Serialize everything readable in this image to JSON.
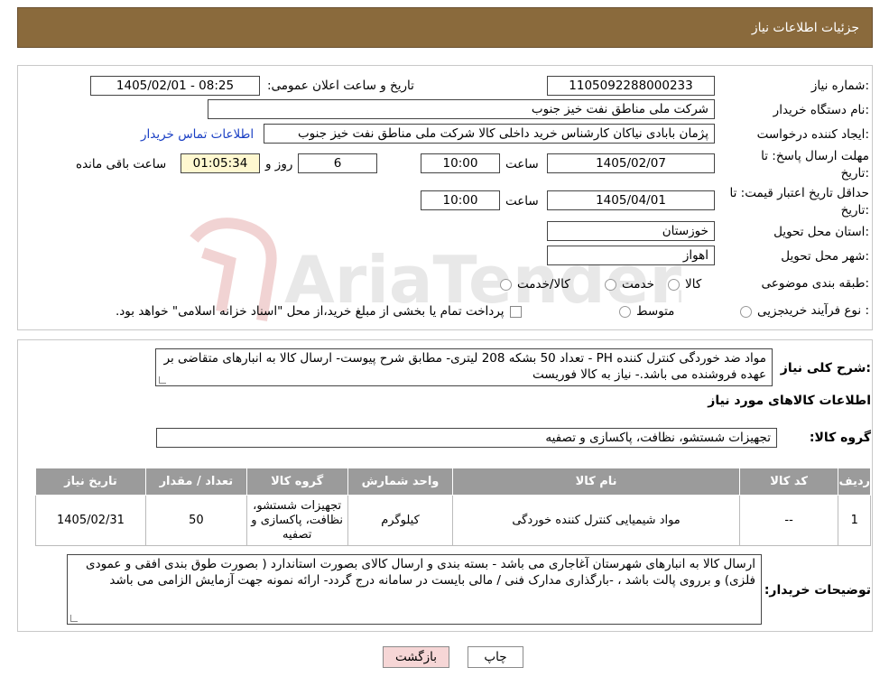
{
  "header": {
    "title": "جزئیات اطلاعات نیاز"
  },
  "form": {
    "need_number_label": "شماره نیاز:",
    "need_number": "1105092288000233",
    "announce_label": "تاریخ و ساعت اعلان عمومی:",
    "announce_value": "1405/02/01 - 08:25",
    "buyer_org_label": "نام دستگاه خریدار:",
    "buyer_org": "شرکت ملی مناطق نفت خیز جنوب",
    "requester_label": "ایجاد کننده درخواست:",
    "requester": "پژمان  بابادی نیاکان  کارشناس خرید داخلی کالا  شرکت ملی مناطق نفت خیز جنوب",
    "contact_link": "اطلاعات تماس خریدار",
    "deadline_label_1": "مهلت ارسال پاسخ: تا",
    "deadline_label_2": "تاریخ:",
    "deadline_date": "1405/02/07",
    "time_label": "ساعت",
    "deadline_time": "10:00",
    "days_value": "6",
    "days_label": "روز و",
    "remaining_time": "01:05:34",
    "remaining_label": "ساعت باقی مانده",
    "price_validity_label_1": "حداقل تاریخ اعتبار قیمت: تا",
    "price_validity_label_2": "تاریخ:",
    "price_validity_date": "1405/04/01",
    "price_validity_time": "10:00",
    "province_label": "استان محل تحویل:",
    "province": "خوزستان",
    "city_label": "شهر محل تحویل:",
    "city": "اهواز",
    "category_label": "طبقه بندی موضوعی:",
    "category_options": [
      "کالا",
      "خدمت",
      "کالا/خدمت"
    ],
    "purchase_type_label": "نوع فرآیند خرید :",
    "purchase_options": [
      "جزیی",
      "متوسط"
    ],
    "purchase_note": "پرداخت تمام یا بخشی از مبلغ خرید،از محل \"اسناد خزانه اسلامی\" خواهد بود."
  },
  "summary": {
    "label": "شرح کلی نیاز:",
    "text": "مواد ضد خوردگی کنترل کننده PH - تعداد 50 بشکه 208 لیتری- مطابق شرح پیوست- ارسال کالا به انبارهای متقاضی بر عهده فروشنده می باشد.- نیاز به کالا فوریست",
    "items_title": "اطلاعات کالاهای مورد نیاز",
    "group_label": "گروه کالا:",
    "group_value": "تجهیزات شستشو، نظافت، پاکسازی و تصفیه"
  },
  "table": {
    "headers": [
      "ردیف",
      "کد کالا",
      "نام کالا",
      "واحد شمارش",
      "گروه کالا",
      "تعداد / مقدار",
      "تاریخ نیاز"
    ],
    "rows": [
      [
        "1",
        "--",
        "مواد شیمیایی کنترل کننده خوردگی",
        "کیلوگرم",
        "تجهیزات شستشو، نظافت، پاکسازی و تصفیه",
        "50",
        "1405/02/31"
      ]
    ]
  },
  "buyer_notes": {
    "label": "توضیحات خریدار:",
    "text": "ارسال کالا به انبارهای  شهرستان آغاجاری می باشد  - بسته بندی و ارسال کالای بصورت استاندارد ( بصورت طوق بندی افقی و عمودی فلزی) و برروی پالت باشد ، -بارگذاری مدارک فنی / مالی بایست  در سامانه درج گردد- ارائه نمونه جهت آزمایش الزامی می باشد"
  },
  "buttons": {
    "print": "چاپ",
    "back": "بازگشت"
  },
  "watermark": {
    "text": "AriaTender.neT"
  },
  "colors": {
    "header": "#8a6a3c",
    "link": "#1a3fc4",
    "back_button": "#f6d6d6",
    "table_header": "#9b9b9b"
  }
}
